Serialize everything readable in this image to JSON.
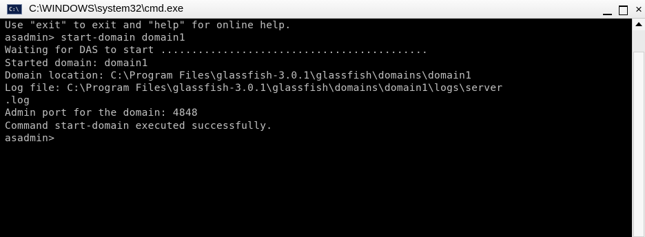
{
  "window": {
    "title": "C:\\WINDOWS\\system32\\cmd.exe",
    "icon": "console-icon",
    "icon_text": "C:\\",
    "close_glyph": "×"
  },
  "console": {
    "lines": [
      "Use \"exit\" to exit and \"help\" for online help.",
      "asadmin> start-domain domain1",
      "Waiting for DAS to start ...........................................",
      "Started domain: domain1",
      "Domain location: C:\\Program Files\\glassfish-3.0.1\\glassfish\\domains\\domain1",
      "Log file: C:\\Program Files\\glassfish-3.0.1\\glassfish\\domains\\domain1\\logs\\server",
      ".log",
      "Admin port for the domain: 4848",
      "Command start-domain executed successfully.",
      "asadmin>"
    ]
  },
  "colors": {
    "console_background": "#000000",
    "console_text": "#c0c0c0",
    "titlebar": "#f0f0f0"
  }
}
